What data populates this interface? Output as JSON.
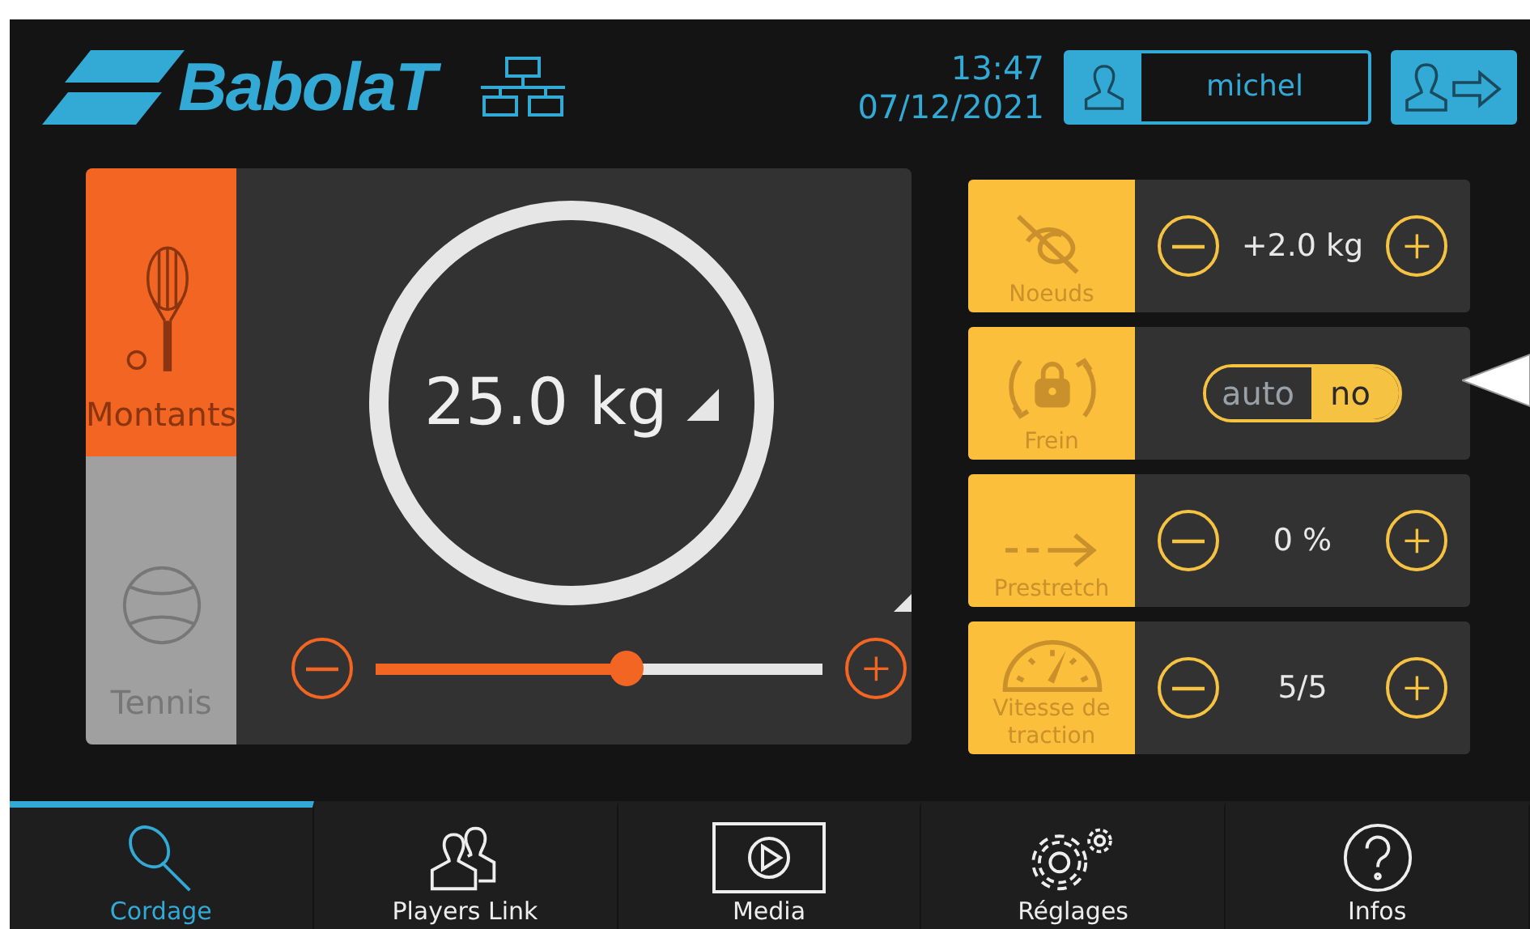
{
  "header": {
    "logo": "BabolaT",
    "time": "13:47",
    "date": "07/12/2021",
    "user": "michel"
  },
  "modes": [
    {
      "label": "Montants",
      "selected": true
    },
    {
      "label": "Tennis",
      "selected": false
    }
  ],
  "tension": {
    "value": "25.0 kg",
    "level": 0.56
  },
  "settings": [
    {
      "label": "Noeuds",
      "kind": "stepper",
      "value": "+2.0 kg"
    },
    {
      "label": "Frein",
      "kind": "toggle",
      "options": [
        {
          "label": "auto",
          "selected": false
        },
        {
          "label": "no",
          "selected": true
        }
      ]
    },
    {
      "label": "Prestretch",
      "kind": "stepper",
      "value": "0 %"
    },
    {
      "label": "Vitesse de traction",
      "kind": "stepper",
      "value": "5/5"
    }
  ],
  "nav": [
    {
      "label": "Cordage",
      "selected": true
    },
    {
      "label": "Players Link",
      "selected": false
    },
    {
      "label": "Media",
      "selected": false
    },
    {
      "label": "Réglages",
      "selected": false
    },
    {
      "label": "Infos",
      "selected": false
    }
  ]
}
